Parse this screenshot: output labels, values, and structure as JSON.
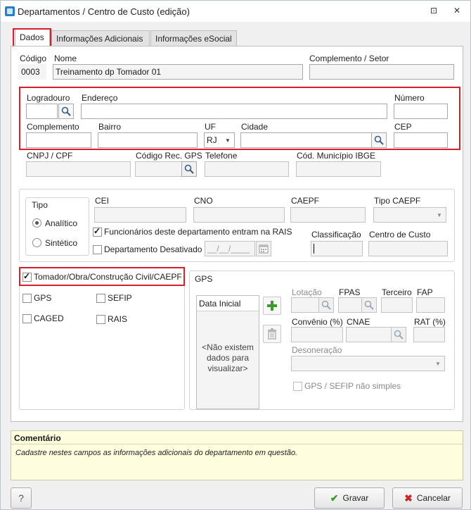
{
  "window": {
    "title": "Departamentos / Centro de Custo (edição)",
    "restore_glyph": "⊡",
    "close_glyph": "✕"
  },
  "tabs": [
    {
      "label": "Dados"
    },
    {
      "label": "Informações Adicionais"
    },
    {
      "label": "Informações eSocial"
    }
  ],
  "header": {
    "codigo_label": "Código",
    "codigo_value": "0003",
    "nome_label": "Nome",
    "nome_value": "Treinamento dp Tomador  01",
    "complemento_setor_label": "Complemento / Setor",
    "complemento_setor_value": ""
  },
  "address": {
    "logradouro_label": "Logradouro",
    "logradouro_value": "",
    "endereco_label": "Endereço",
    "endereco_value": "",
    "numero_label": "Número",
    "numero_value": "",
    "complemento_label": "Complemento",
    "complemento_value": "",
    "bairro_label": "Bairro",
    "bairro_value": "",
    "uf_label": "UF",
    "uf_value": "RJ",
    "cidade_label": "Cidade",
    "cidade_value": "",
    "cep_label": "CEP",
    "cep_value": ""
  },
  "ids": {
    "cnpj_label": "CNPJ / CPF",
    "codigo_rec_gps_label": "Código Rec. GPS",
    "telefone_label": "Telefone",
    "cod_municipio_label": "Cód. Município IBGE"
  },
  "tipo": {
    "legend": "Tipo",
    "options": [
      {
        "label": "Analítico",
        "selected": true
      },
      {
        "label": "Sintético",
        "selected": false
      }
    ]
  },
  "registry": {
    "cei_label": "CEI",
    "cno_label": "CNO",
    "caepf_label": "CAEPF",
    "tipo_caepf_label": "Tipo CAEPF",
    "funcionarios_rais_label": "Funcionários deste departamento entram na RAIS",
    "funcionarios_rais_checked": true,
    "desativado_label": "Departamento Desativado",
    "desativado_checked": false,
    "date_placeholder": "__/__/____",
    "classificacao_label": "Classificação",
    "centro_custo_label": "Centro de Custo"
  },
  "tomador": {
    "label": "Tomador/Obra/Construção Civil/CAEPF",
    "checked": true,
    "options": [
      {
        "label": "GPS",
        "checked": false
      },
      {
        "label": "SEFIP",
        "checked": false
      },
      {
        "label": "CAGED",
        "checked": false
      },
      {
        "label": "RAIS",
        "checked": false
      }
    ]
  },
  "gps": {
    "legend": "GPS",
    "list_header": "Data Inicial",
    "empty_message": "<Não existem dados para visualizar>",
    "lotacao_label": "Lotação",
    "fpas_label": "FPAS",
    "terceiro_label": "Terceiro",
    "fap_label": "FAP",
    "convenio_label": "Convênio (%)",
    "cnae_label": "CNAE",
    "rat_label": "RAT (%)",
    "desoneracao_label": "Desoneração",
    "gps_sefip_label": "GPS / SEFIP não simples"
  },
  "comment": {
    "title": "Comentário",
    "text": "Cadastre nestes campos as informações adicionais do departamento em questão."
  },
  "footer": {
    "help_label": "?",
    "save_label": "Gravar",
    "cancel_label": "Cancelar"
  },
  "colors": {
    "highlight": "#d6212b",
    "comment_bg": "#fefede",
    "add_green": "#3a9a2a",
    "cancel_red": "#c62828"
  }
}
